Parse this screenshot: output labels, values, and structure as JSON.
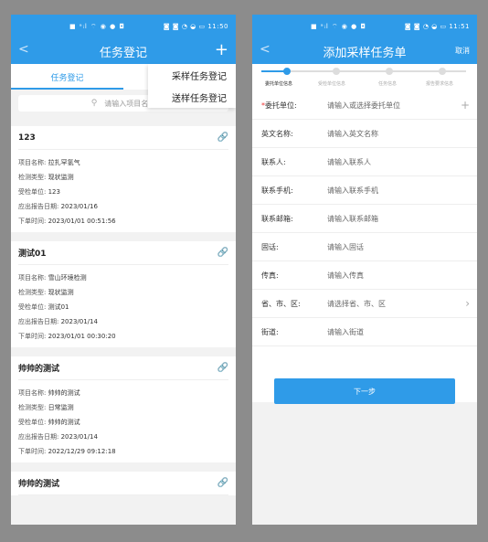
{
  "phone1": {
    "status": {
      "center": "■ ᵃᵢl ⌔ ◉ ● ◘",
      "right": "◙ ◙ ◔ ◒ ▭ 11:50"
    },
    "nav": {
      "back": "<",
      "title": "任务登记",
      "plus": "+"
    },
    "tabs": [
      "任务登记",
      ""
    ],
    "dropdown": [
      "采样任务登记",
      "送样任务登记"
    ],
    "search": {
      "placeholder": "请输入项目名称",
      "icon": "⚲"
    },
    "cards": [
      {
        "title": "123",
        "rows": [
          {
            "k": "项目名称:",
            "v": "拉扎罕氢气"
          },
          {
            "k": "检测类型:",
            "v": "现状监测"
          },
          {
            "k": "受检单位:",
            "v": "123"
          },
          {
            "k": "应出报告日期:",
            "v": "2023/01/16"
          },
          {
            "k": "下单时间:",
            "v": "2023/01/01 00:51:56"
          }
        ]
      },
      {
        "title": "测试01",
        "rows": [
          {
            "k": "项目名称:",
            "v": "雪山环境检测"
          },
          {
            "k": "检测类型:",
            "v": "现状监测"
          },
          {
            "k": "受检单位:",
            "v": "测试01"
          },
          {
            "k": "应出报告日期:",
            "v": "2023/01/14"
          },
          {
            "k": "下单时间:",
            "v": "2023/01/01 00:30:20"
          }
        ]
      },
      {
        "title": "帅帅的测试",
        "rows": [
          {
            "k": "项目名称:",
            "v": "帅帅的测试"
          },
          {
            "k": "检测类型:",
            "v": "日常监测"
          },
          {
            "k": "受检单位:",
            "v": "帅帅的测试"
          },
          {
            "k": "应出报告日期:",
            "v": "2023/01/14"
          },
          {
            "k": "下单时间:",
            "v": "2022/12/29 09:12:18"
          }
        ]
      },
      {
        "title": "帅帅的测试",
        "rows": []
      }
    ]
  },
  "phone2": {
    "status": {
      "center": "■ ᵃᵢl ⌔ ◉ ● ◘",
      "right": "◙ ◙ ◔ ◒ ▭ 11:51"
    },
    "nav": {
      "back": "<",
      "title": "添加采样任务单",
      "cancel": "取消"
    },
    "steps": [
      "委托单位信息",
      "受检单位信息",
      "任务信息",
      "报告要求信息"
    ],
    "form": [
      {
        "label": "委托单位:",
        "required": "*",
        "placeholder": "请输入或选择委托单位",
        "side": "+"
      },
      {
        "label": "英文名称:",
        "placeholder": "请输入英文名称"
      },
      {
        "label": "联系人:",
        "placeholder": "请输入联系人"
      },
      {
        "label": "联系手机:",
        "placeholder": "请输入联系手机"
      },
      {
        "label": "联系邮箱:",
        "placeholder": "请输入联系邮箱"
      },
      {
        "label": "固话:",
        "placeholder": "请输入固话"
      },
      {
        "label": "传真:",
        "placeholder": "请输入传真"
      },
      {
        "label": "省、市、区:",
        "placeholder": "请选择省、市、区",
        "side": "›"
      },
      {
        "label": "街道:",
        "placeholder": "请输入街道"
      }
    ],
    "next_label": "下一步"
  }
}
